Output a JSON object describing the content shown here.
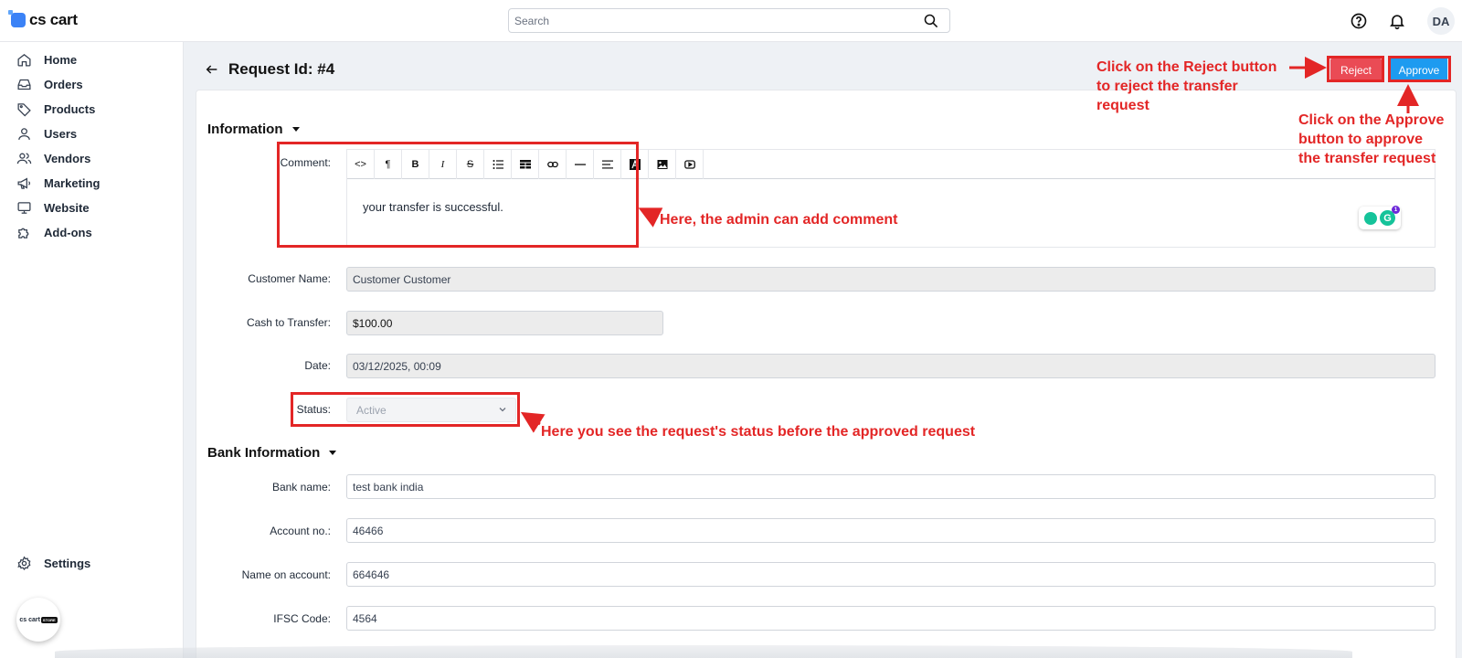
{
  "app": {
    "logo_text": "cs cart"
  },
  "search": {
    "placeholder": "Search"
  },
  "user": {
    "initials": "DA"
  },
  "sidebar": {
    "items": [
      {
        "label": "Home",
        "icon": "home-icon"
      },
      {
        "label": "Orders",
        "icon": "inbox-icon"
      },
      {
        "label": "Products",
        "icon": "tag-icon"
      },
      {
        "label": "Users",
        "icon": "user-icon"
      },
      {
        "label": "Vendors",
        "icon": "users-icon"
      },
      {
        "label": "Marketing",
        "icon": "megaphone-icon"
      },
      {
        "label": "Website",
        "icon": "monitor-icon"
      },
      {
        "label": "Add-ons",
        "icon": "puzzle-icon"
      }
    ],
    "settings_label": "Settings",
    "brand_bubble": {
      "text": "cs cart",
      "tag": "STORE"
    }
  },
  "page": {
    "title": "Request Id: #4",
    "reject_label": "Reject",
    "approve_label": "Approve"
  },
  "information": {
    "title": "Information",
    "comment_label": "Comment:",
    "comment_text": "your transfer is successful.",
    "customer_name_label": "Customer Name:",
    "customer_name": "Customer Customer",
    "cash_label": "Cash to Transfer:",
    "cash": "$100.00",
    "date_label": "Date:",
    "date": "03/12/2025, 00:09",
    "status_label": "Status:",
    "status": "Active"
  },
  "bank": {
    "title": "Bank Information",
    "bank_name_label": "Bank name:",
    "bank_name": "test bank india",
    "account_label": "Account no.:",
    "account": "46466",
    "name_on_account_label": "Name on account:",
    "name_on_account": "664646",
    "ifsc_label": "IFSC Code:",
    "ifsc": "4564"
  },
  "annotations": {
    "reject": [
      "Click on the Reject button",
      "to reject the transfer",
      "request"
    ],
    "approve": [
      "Click on the Approve",
      "button to approve",
      "the transfer request"
    ],
    "comment": "Here, the admin can add comment",
    "status": "Here you see the request's status before the approved request"
  },
  "grammarly": {
    "badge_count": "1",
    "letter": "G"
  },
  "colors": {
    "annotation_red": "#e32626",
    "reject": "#ea4b55",
    "approve": "#1d9bf0"
  }
}
